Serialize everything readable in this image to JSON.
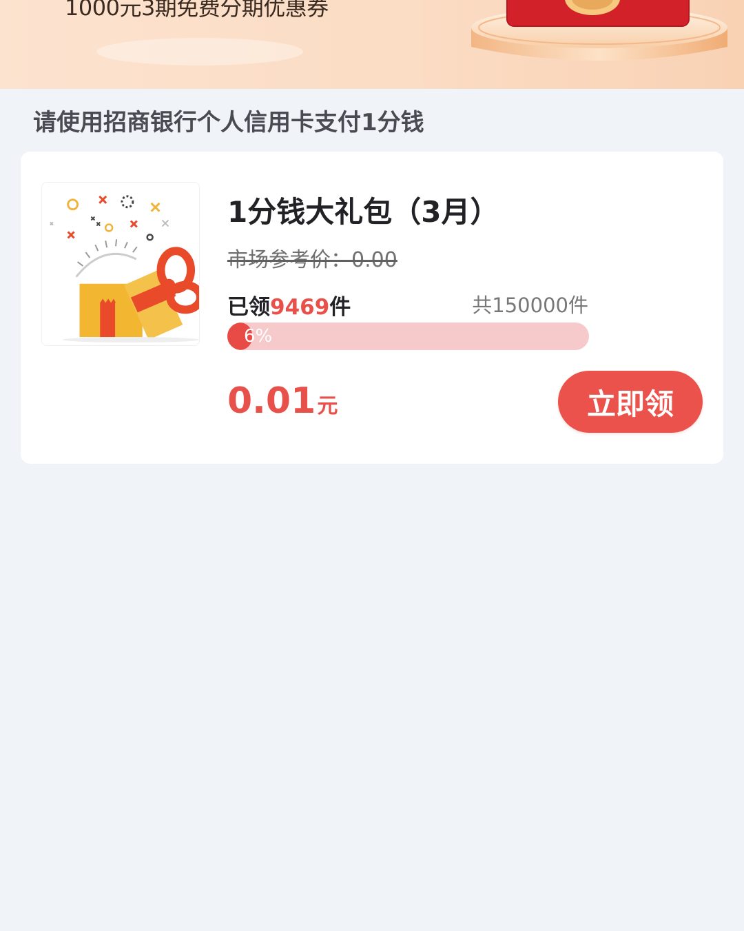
{
  "banner": {
    "text": "1000元3期免费分期优惠券"
  },
  "section": {
    "title": "请使用招商银行个人信用卡支付1分钱"
  },
  "product": {
    "name": "1分钱大礼包（3月）",
    "market_price": "市场参考价：0.00",
    "claimed_prefix": "已领",
    "claimed_count": "9469",
    "claimed_suffix": "件",
    "total": "共150000件",
    "progress_text": "6%",
    "progress_fraction": 0.06,
    "price_amount": "0.01",
    "price_unit": "元",
    "claim_button_label": "立即领"
  },
  "colors": {
    "accent": "#e8504a",
    "progress_track": "#f6caca",
    "page_background": "#f0f4f8"
  },
  "icons": [
    "gift-box-icon",
    "red-envelope-icon"
  ]
}
